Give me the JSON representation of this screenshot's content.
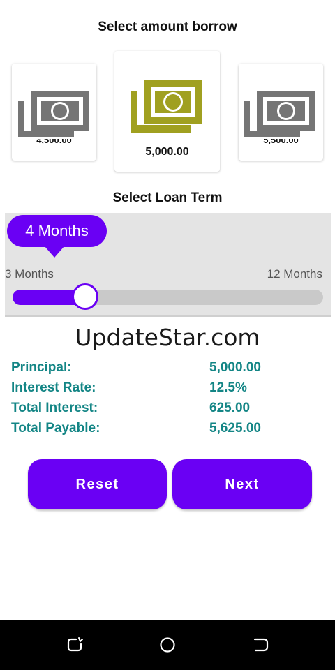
{
  "amount_section": {
    "title": "Select amount borrow",
    "options": [
      {
        "amount": "4,500.00",
        "selected": false
      },
      {
        "amount": "5,000.00",
        "selected": true
      },
      {
        "amount": "5,500.00",
        "selected": false
      }
    ]
  },
  "loan_term": {
    "title": "Select Loan Term",
    "bubble_label": "4 Months",
    "min_label": "3 Months",
    "max_label": "12 Months",
    "min": 3,
    "max": 12,
    "value": 4
  },
  "watermark": "UpdateStar.com",
  "summary": [
    {
      "label": "Principal:",
      "value": "5,000.00"
    },
    {
      "label": "Interest Rate:",
      "value": "12.5%"
    },
    {
      "label": "Total Interest:",
      "value": "625.00"
    },
    {
      "label": "Total Payable:",
      "value": "5,625.00"
    }
  ],
  "buttons": {
    "reset": "Reset",
    "next": "Next"
  },
  "colors": {
    "accent": "#6a00f4",
    "selected_icon": "#a0a020",
    "unselected_icon": "#757575",
    "summary_text": "#138585"
  },
  "icons": {
    "money": "money-bill-stack-icon",
    "nav_recent": "recent-apps-icon",
    "nav_home": "home-icon",
    "nav_back": "back-icon"
  }
}
